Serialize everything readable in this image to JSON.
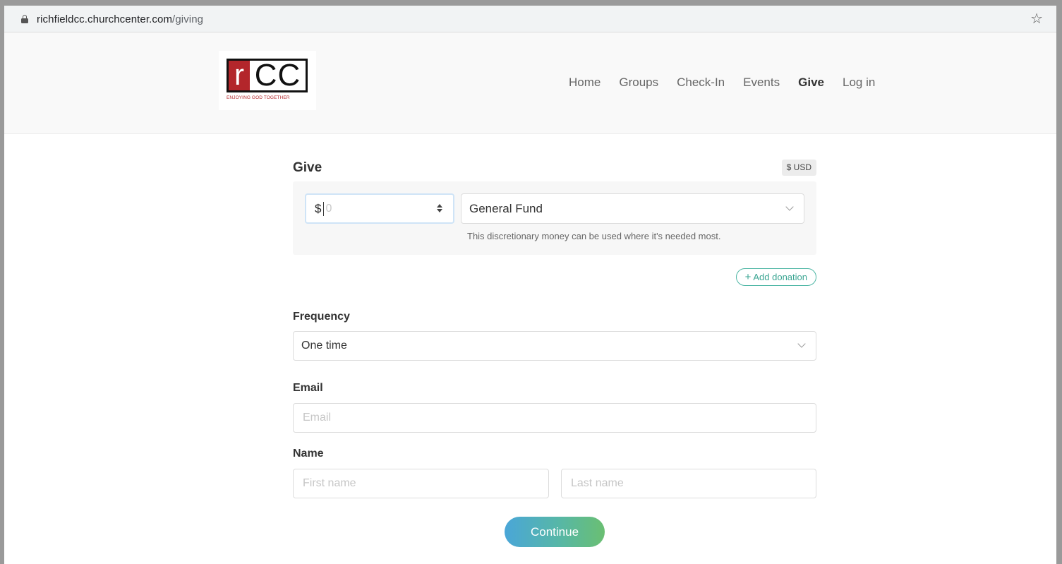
{
  "browser": {
    "url_host": "richfieldcc.churchcenter.com",
    "url_path": "/giving"
  },
  "logo": {
    "letter": "r",
    "letters": "CC",
    "tagline": "ENJOYING GOD TOGETHER"
  },
  "nav": {
    "items": [
      {
        "label": "Home"
      },
      {
        "label": "Groups"
      },
      {
        "label": "Check-In"
      },
      {
        "label": "Events"
      },
      {
        "label": "Give",
        "active": true
      },
      {
        "label": "Log in"
      }
    ]
  },
  "give": {
    "title": "Give",
    "currency": "$ USD",
    "amount_prefix": "$",
    "amount_placeholder": "0",
    "fund": "General Fund",
    "fund_description": "This discretionary money can be used where it's needed most.",
    "add_donation": "Add donation",
    "add_donation_icon": "+"
  },
  "frequency": {
    "label": "Frequency",
    "selected": "One time"
  },
  "email": {
    "label": "Email",
    "placeholder": "Email"
  },
  "name": {
    "label": "Name",
    "first_placeholder": "First name",
    "last_placeholder": "Last name"
  },
  "continue_label": "Continue",
  "colors": {
    "accent": "#3aa592",
    "logo_red": "#b3262b",
    "gradient_start": "#4aa6d8",
    "gradient_end": "#6abf72"
  }
}
